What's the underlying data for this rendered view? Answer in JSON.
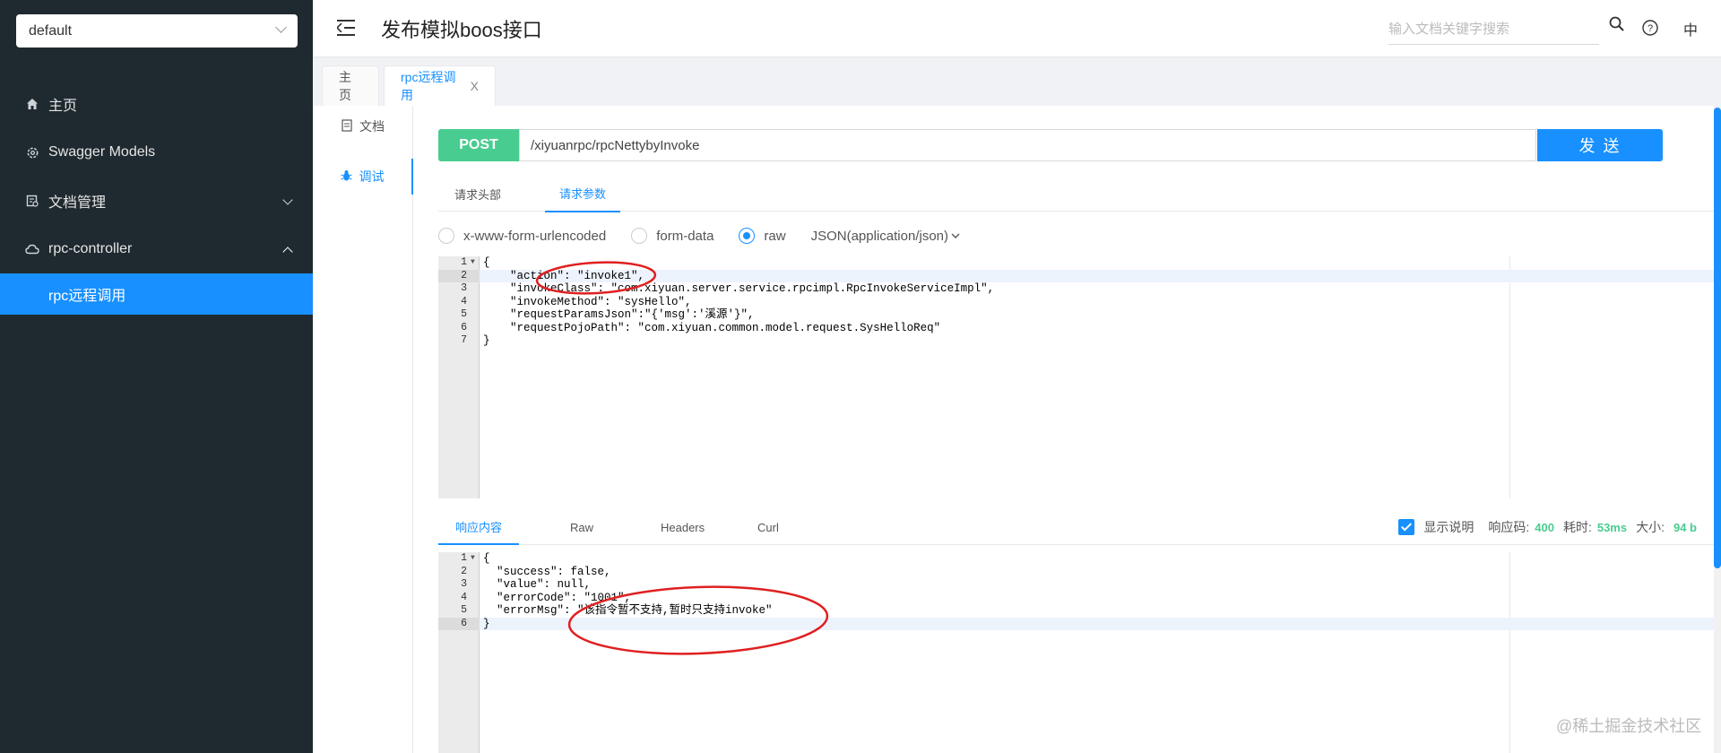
{
  "sidebar": {
    "project_select": "default",
    "items": [
      {
        "label": "主页",
        "icon": "home-icon"
      },
      {
        "label": "Swagger Models",
        "icon": "settings-icon"
      },
      {
        "label": "文档管理",
        "icon": "document-manage-icon"
      },
      {
        "label": "rpc-controller",
        "icon": "cloud-icon"
      }
    ],
    "sub_item": "rpc远程调用"
  },
  "header": {
    "title": "发布模拟boos接口",
    "search_placeholder": "输入文档关键字搜索",
    "lang": "中"
  },
  "tabs": [
    {
      "label": "主页"
    },
    {
      "label": "rpc远程调用",
      "close": "X"
    }
  ],
  "subnav": {
    "doc": "文档",
    "debug": "调试"
  },
  "request": {
    "method": "POST",
    "url": "/xiyuanrpc/rpcNettybyInvoke",
    "send": "发 送",
    "tabs": [
      "请求头部",
      "请求参数"
    ],
    "body_types": [
      "x-www-form-urlencoded",
      "form-data",
      "raw"
    ],
    "content_type": "JSON(application/json)",
    "body_lines": [
      "{",
      "    \"action\": \"invoke1\",",
      "    \"invokeClass\": \"com.xiyuan.server.service.rpcimpl.RpcInvokeServiceImpl\",",
      "    \"invokeMethod\": \"sysHello\",",
      "    \"requestParamsJson\":\"{'msg':'溪源'}\",",
      "    \"requestPojoPath\": \"com.xiyuan.common.model.request.SysHelloReq\"",
      "}"
    ]
  },
  "response": {
    "tabs": [
      "响应内容",
      "Raw",
      "Headers",
      "Curl"
    ],
    "show_desc": "显示说明",
    "code_label": "响应码:",
    "code": "400",
    "time_label": "耗时:",
    "time": "53ms",
    "size_label": "大小:",
    "size": "94 b",
    "body_lines": [
      "{",
      "  \"success\": false,",
      "  \"value\": null,",
      "  \"errorCode\": \"1001\",",
      "  \"errorMsg\": \"该指令暂不支持,暂时只支持invoke\"",
      "}"
    ]
  },
  "watermark": "@稀土掘金技术社区",
  "colors": {
    "sidebar_bg": "#1f2a30",
    "accent": "#1890ff",
    "post": "#49cc90",
    "annotation": "#e02020"
  }
}
